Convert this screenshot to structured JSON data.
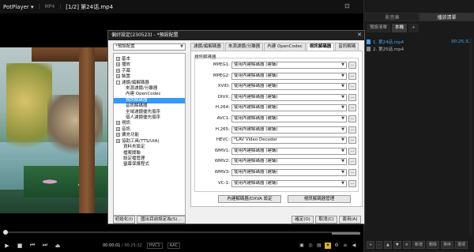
{
  "titlebar": {
    "app": "PotPlayer",
    "menu_arrow": "▾",
    "format": "MP4",
    "file": "[1/2] 第24话.mp4"
  },
  "controls": {
    "time_current": "00:00:01",
    "time_sep": " / ",
    "time_total": "00:25:32",
    "codec1": "HVC1",
    "codec2": "AAC"
  },
  "playlist": {
    "tabs": [
      "影音庫",
      "播放清單"
    ],
    "active_tab": 1,
    "subtabs": [
      "預設清單",
      "本機",
      "+"
    ],
    "items": [
      {
        "name": "1. 第24话.mp4",
        "duration": "00:25:32",
        "active": true
      },
      {
        "name": "2. 第25话.mp4",
        "duration": "",
        "active": false
      }
    ],
    "buttons": [
      "+",
      "-",
      "▲",
      "▼",
      "≡",
      "新增",
      "刪除",
      "排序",
      "選項"
    ]
  },
  "dialog": {
    "title": "偏好設定(230523) - *預設配置",
    "close": "✕",
    "profile": "*預設配置",
    "tree": [
      {
        "label": "基本",
        "level": 0,
        "toggle": "+"
      },
      {
        "label": "播放",
        "level": 0,
        "toggle": "+"
      },
      {
        "label": "字幕",
        "level": 0,
        "toggle": "+"
      },
      {
        "label": "裝置",
        "level": 0,
        "toggle": "+"
      },
      {
        "label": "濾鏡/編解碼器",
        "level": 0,
        "toggle": "-"
      },
      {
        "label": "來源濾鏡/分離器",
        "level": 1,
        "toggle": ""
      },
      {
        "label": "內建 OpenCodec",
        "level": 1,
        "toggle": ""
      },
      {
        "label": "視訊解碼器",
        "level": 1,
        "toggle": "",
        "selected": true
      },
      {
        "label": "音訊解碼器",
        "level": 1,
        "toggle": ""
      },
      {
        "label": "全域濾鏡優先順序",
        "level": 1,
        "toggle": ""
      },
      {
        "label": "個人濾鏡優先順序",
        "level": 1,
        "toggle": ""
      },
      {
        "label": "視訊",
        "level": 0,
        "toggle": "+"
      },
      {
        "label": "音訊",
        "level": 0,
        "toggle": "+"
      },
      {
        "label": "擴充功能",
        "level": 0,
        "toggle": "+"
      },
      {
        "label": "協助工具(TTS/UIA)",
        "level": 0,
        "toggle": "+"
      },
      {
        "label": "資料夾設定",
        "level": 0,
        "toggle": ""
      },
      {
        "label": "檔案關聯",
        "level": 0,
        "toggle": ""
      },
      {
        "label": "設定檔管理",
        "level": 0,
        "toggle": ""
      },
      {
        "label": "螢幕保護程式",
        "level": 0,
        "toggle": ""
      }
    ],
    "tabs": [
      "濾鏡/編解碼器",
      "來源濾鏡/分離器",
      "內建 OpenCodec",
      "視訊解碼器",
      "音訊解碼"
    ],
    "active_tab": 3,
    "group_title": "視訊解碼器",
    "rows": [
      {
        "label": "MPEG1:",
        "value": "使用內建解碼器 (建議)"
      },
      {
        "label": "MPEG2:",
        "value": "使用內建解碼器 (建議)"
      },
      {
        "label": "XVID:",
        "value": "使用內建解碼器 (建議)"
      },
      {
        "label": "DIVX:",
        "value": "使用內建解碼器 (建議)"
      },
      {
        "label": "H.264:",
        "value": "使用內建解碼器 (建議)"
      },
      {
        "label": "AVC1:",
        "value": "使用內建解碼器 (建議)"
      },
      {
        "label": "H.265:",
        "value": "使用內建解碼器 (建議)"
      },
      {
        "label": "HEVC:",
        "value": "*LAV Video Decoder"
      },
      {
        "label": "WMV1:",
        "value": "使用內建解碼器 (建議)"
      },
      {
        "label": "WMV2:",
        "value": "使用內建解碼器 (建議)"
      },
      {
        "label": "WMV3:",
        "value": "使用內建解碼器 (建議)"
      },
      {
        "label": "VC-1:",
        "value": "使用內建解碼器 (建議)"
      }
    ],
    "more_label": "...",
    "dropdown_arrow": "▼",
    "btn_builtin_dxva": "內建解碼器/DXVA 設定",
    "btn_video_decoder_mgmt": "視訊解碼器管理",
    "btn_init": "初始化(I)",
    "btn_export": "匯出目前設定為(S)...",
    "btn_ok": "確定(O)",
    "btn_cancel": "取消(C)",
    "btn_apply": "套用(A)"
  }
}
